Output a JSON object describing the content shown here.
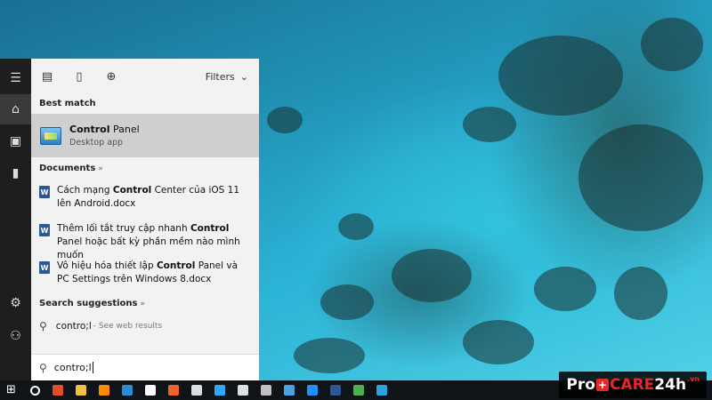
{
  "start_menu": {
    "rail": {
      "icons": [
        "hamburger-icon",
        "home-icon",
        "user-card-icon",
        "battery-icon",
        "gear-icon",
        "user-icon"
      ]
    },
    "topbar": {
      "icons": [
        "apps-icon",
        "document-icon",
        "globe-icon"
      ],
      "filters_label": "Filters"
    },
    "best_match": {
      "heading": "Best match",
      "app_name_bold": "Control",
      "app_name_rest": " Panel",
      "app_type": "Desktop app"
    },
    "documents": {
      "heading": "Documents",
      "items": [
        {
          "pre": "Cách mạng ",
          "bold": "Control",
          "post": " Center của iOS 11 lên Android.docx"
        },
        {
          "pre": "Thêm lối tắt truy cập nhanh ",
          "bold": "Control",
          "post": " Panel hoặc bất kỳ phần mềm nào mình muốn"
        },
        {
          "pre": "Vô hiệu hóa thiết lập ",
          "bold": "Control",
          "post": " Panel và PC Settings trên Windows 8.docx"
        }
      ]
    },
    "suggestions": {
      "heading": "Search suggestions",
      "item_query": "contro;l",
      "item_hint": "- See web results"
    },
    "search_box": {
      "value": "contro;l"
    }
  },
  "taskbar": {
    "icons": [
      "windows-icon",
      "cortana-icon",
      "chrome-icon",
      "file-explorer-icon",
      "media-player-icon",
      "network-icon",
      "store-icon",
      "xampp-icon",
      "mail-icon",
      "photoshop-icon",
      "app-icon",
      "app-icon-2",
      "app-icon-3",
      "messenger-icon",
      "word-icon",
      "chrome-icon-2",
      "telegram-icon"
    ],
    "colors": [
      "#ffffff",
      "#ffffff",
      "#e44d26",
      "#f0c040",
      "#ff8c00",
      "#2b8cd6",
      "#ffffff",
      "#f0632b",
      "#dddddd",
      "#31a8ff",
      "#e0e0e0",
      "#c0c0c0",
      "#4aa3df",
      "#1e90ff",
      "#2b5797",
      "#4caf50",
      "#2aa3de"
    ]
  },
  "watermark": {
    "pro": "Pro",
    "plus": "+",
    "care": "CARE",
    "num": "24h",
    "tld": ".vn"
  }
}
